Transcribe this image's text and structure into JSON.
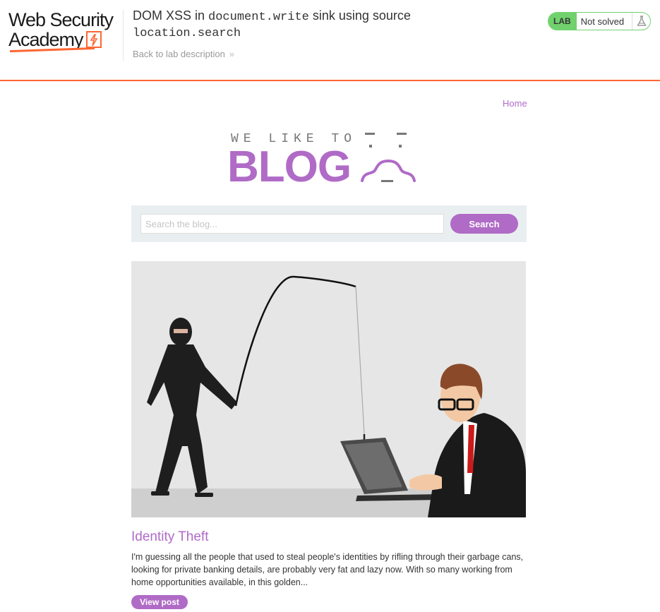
{
  "academy": {
    "logo_line1": "Web Security",
    "logo_line2": "Academy",
    "lab_title_prefix": "DOM XSS in ",
    "lab_title_code1": "document.write",
    "lab_title_middle": " sink using source",
    "lab_title_code2": "location.search",
    "back_link": "Back to lab description",
    "back_chevrons": "»",
    "status_badge": "LAB",
    "status_text": "Not solved"
  },
  "blog": {
    "nav_home": "Home",
    "logo_small": "WE LIKE TO",
    "logo_big": "BLOG",
    "search": {
      "placeholder": "Search the blog...",
      "button_label": "Search"
    },
    "post": {
      "title": "Identity Theft",
      "summary": "I'm guessing all the people that used to steal people's identities by rifling through their garbage cans, looking for private banking details, are probably very fat and lazy now. With so many working from home opportunities available, in this golden...",
      "button_label": "View post"
    }
  },
  "colors": {
    "accent_orange": "#ff6633",
    "accent_purple": "#b06bc6",
    "status_green": "#70d16d",
    "search_bg": "#e9eef0"
  },
  "icons": [
    "lightning-bolt-icon",
    "flask-icon",
    "double-chevron-right-icon"
  ]
}
